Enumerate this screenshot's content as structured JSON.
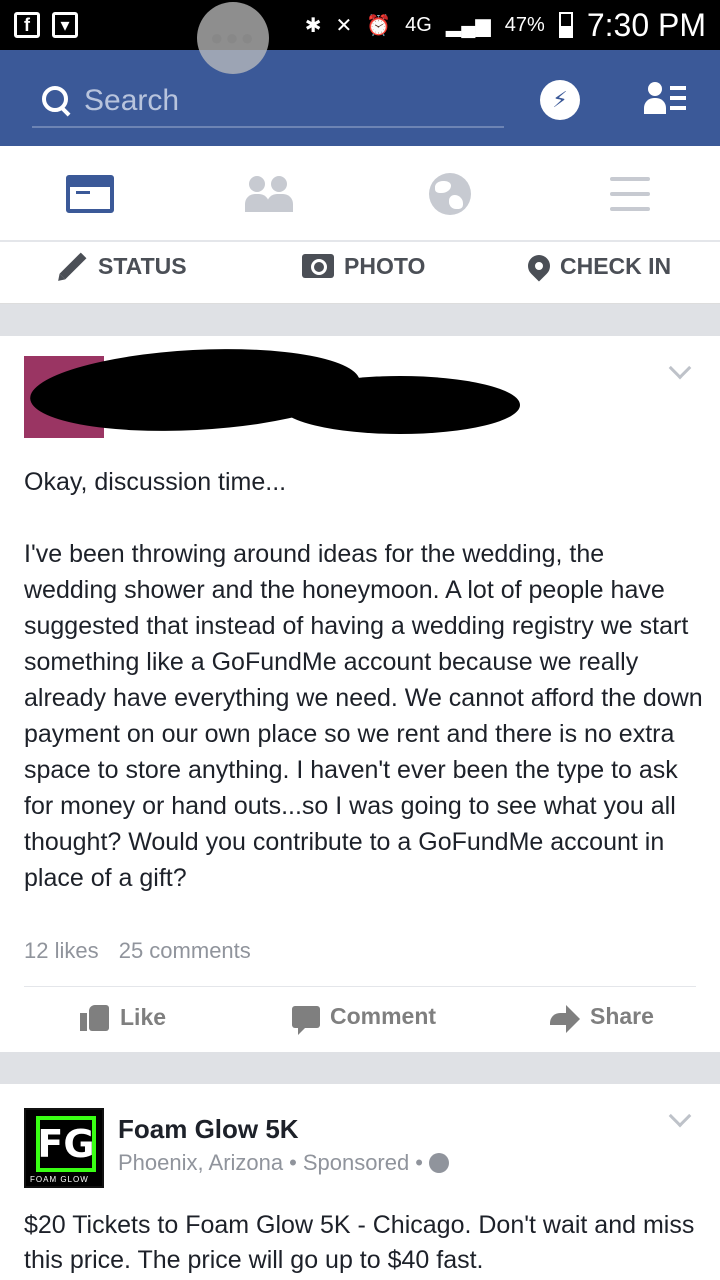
{
  "status_bar": {
    "network": "4G",
    "battery": "47%",
    "time": "7:30 PM",
    "bubble": "●●●"
  },
  "header": {
    "search_placeholder": "Search",
    "messenger_glyph": "⚡"
  },
  "nav": {
    "tabs": [
      "news-feed",
      "friend-requests",
      "notifications",
      "more"
    ]
  },
  "composer": {
    "status_label": "STATUS",
    "photo_label": "PHOTO",
    "checkin_label": "CHECK IN"
  },
  "post": {
    "intro": "Okay, discussion time...",
    "body": "I've been throwing around ideas for the wedding, the wedding shower and the honeymoon. A lot of people have suggested that instead of having a wedding registry we start something like a GoFundMe account because we really already have everything we need. We cannot afford the down payment on our own place so we rent and there is no extra space to store anything. I haven't ever been the type to ask for money or hand outs...so I was going to see what you all thought? Would you contribute to a GoFundMe account in place of a gift?",
    "likes": "12 likes",
    "comments": "25 comments",
    "like_label": "Like",
    "comment_label": "Comment",
    "share_label": "Share"
  },
  "ad": {
    "logo_text": "FG",
    "logo_caption": "FOAM GLOW",
    "name": "Foam Glow 5K",
    "location": "Phoenix, Arizona",
    "sponsored": "Sponsored",
    "separator": "•",
    "text": "$20 Tickets to Foam Glow 5K - Chicago. Don't wait and miss this price. The price will go up to $40 fast."
  },
  "colors": {
    "brand": "#3b5998",
    "feed_bg": "#dfe1e5",
    "text": "#1d2129",
    "muted": "#90949c"
  }
}
